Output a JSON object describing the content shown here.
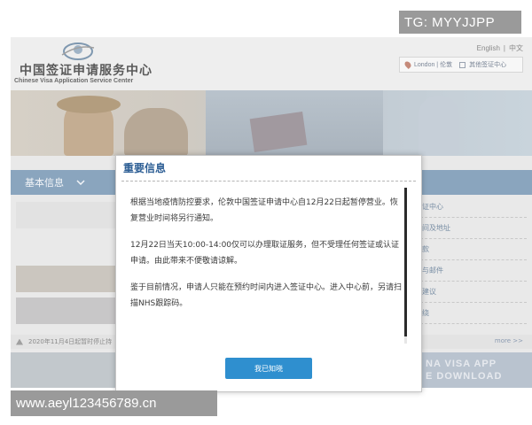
{
  "site": {
    "logo_cn": "中国签证申请服务中心",
    "logo_en": "Chinese Visa Application Service Center",
    "lang_en": "English",
    "lang_sep": "|",
    "lang_cn": "中文",
    "center_location": "London | 伦敦",
    "other_centers": "其他签证中心",
    "basic_info": "基本信息",
    "right_items": [
      "证中心",
      "间及地址",
      "款",
      "与邮件",
      "建议",
      "绕"
    ],
    "notice_text": "2020年11月4日起暂时停止持",
    "more_link": "more >>",
    "app_banner_line1": "NA VISA APP",
    "app_banner_line2": "E DOWNLOAD"
  },
  "modal": {
    "title": "重要信息",
    "paragraphs": [
      "根据当地疫情防控要求，伦敦中国签证申请中心自12月22日起暂停营业。恢复营业时间将另行通知。",
      "12月22日当天10:00-14:00仅可以办理取证服务，但不受理任何签证或认证申请。由此带来不便敬请谅解。",
      "鉴于目前情况，申请人只能在预约时间内进入签证中心。进入中心前，另请扫描NHS跟踪码。"
    ],
    "confirm_label": "我已知晓"
  },
  "watermarks": {
    "top": "TG: MYYJJPP",
    "bottom": "www.aeyl123456789.cn"
  }
}
